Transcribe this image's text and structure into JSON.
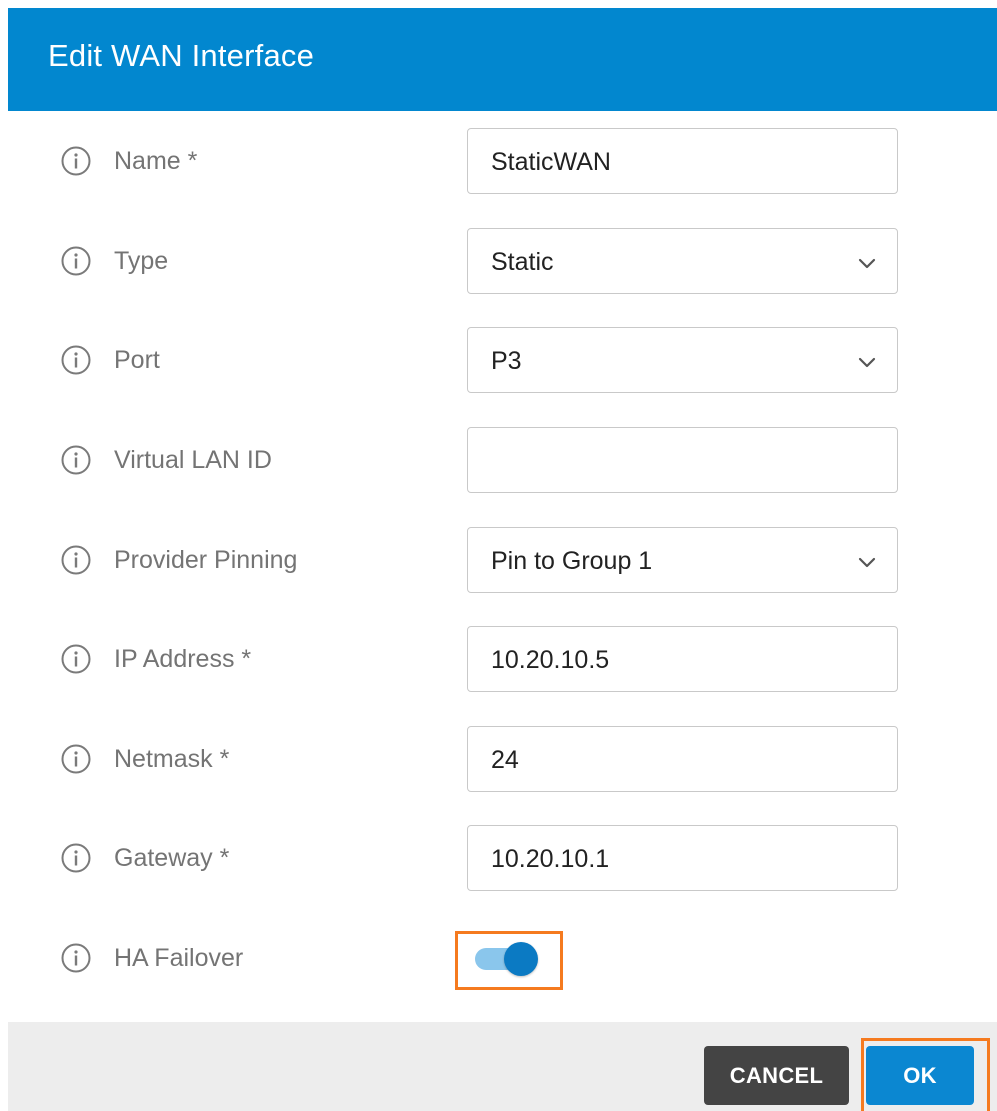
{
  "dialog": {
    "title": "Edit WAN Interface"
  },
  "fields": [
    {
      "label": "Name *",
      "value": "StaticWAN",
      "kind": "text"
    },
    {
      "label": "Type",
      "value": "Static",
      "kind": "select"
    },
    {
      "label": "Port",
      "value": "P3",
      "kind": "select"
    },
    {
      "label": "Virtual LAN ID",
      "value": "",
      "kind": "text"
    },
    {
      "label": "Provider Pinning",
      "value": "Pin to Group 1",
      "kind": "select"
    },
    {
      "label": "IP Address *",
      "value": "10.20.10.5",
      "kind": "text"
    },
    {
      "label": "Netmask *",
      "value": "24",
      "kind": "text"
    },
    {
      "label": "Gateway *",
      "value": "10.20.10.1",
      "kind": "text"
    }
  ],
  "ha_failover": {
    "label": "HA Failover",
    "enabled": true
  },
  "footer": {
    "cancel_label": "CANCEL",
    "ok_label": "OK"
  },
  "icons": {
    "info": "info-circle-icon",
    "dropdown": "chevron-down-icon"
  },
  "colors": {
    "header_bg": "#0287cf",
    "highlight": "#f57a1f",
    "toggle_on": "#0b7ac3",
    "ok_button": "#0b87d1",
    "cancel_button": "#444444"
  }
}
